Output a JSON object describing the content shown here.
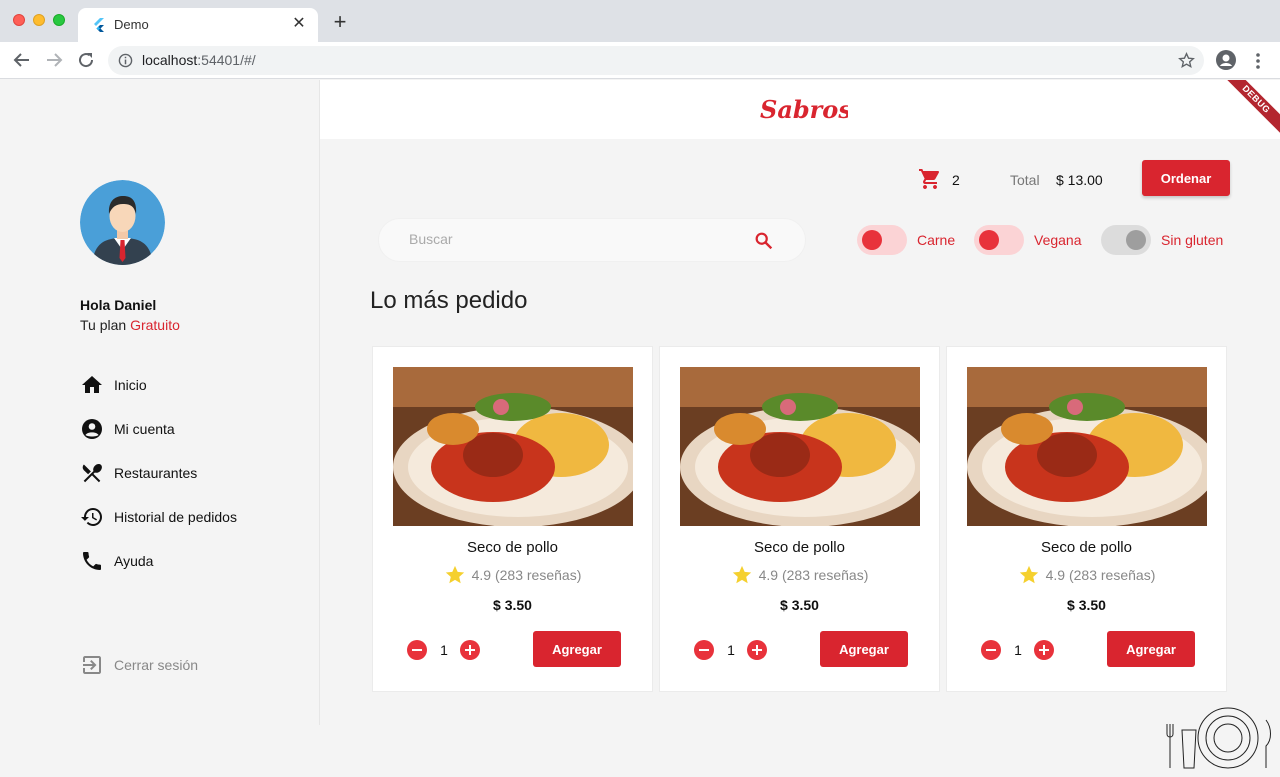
{
  "browser": {
    "tab_title": "Demo",
    "url_host": "localhost",
    "url_rest": ":54401/#/"
  },
  "colors": {
    "accent": "#d9252f",
    "switch_on": "#e8323b"
  },
  "sidebar": {
    "greeting": "Hola Daniel",
    "plan_label": "Tu plan",
    "plan_value": "Gratuito",
    "items": [
      {
        "label": "Inicio",
        "icon": "home-icon"
      },
      {
        "label": "Mi cuenta",
        "icon": "account-icon"
      },
      {
        "label": "Restaurantes",
        "icon": "restaurant-icon"
      },
      {
        "label": "Historial de pedidos",
        "icon": "history-icon"
      },
      {
        "label": "Ayuda",
        "icon": "phone-icon"
      }
    ],
    "logout_label": "Cerrar sesión"
  },
  "header": {
    "logo_text": "Sabroso",
    "debug_label": "DEBUG"
  },
  "cart": {
    "count": "2",
    "total_label": "Total",
    "total_value": "$ 13.00",
    "order_label": "Ordenar"
  },
  "search": {
    "placeholder": "Buscar",
    "value": ""
  },
  "filters": [
    {
      "label": "Carne",
      "on": true
    },
    {
      "label": "Vegana",
      "on": true
    },
    {
      "label": "Sin gluten",
      "on": false
    }
  ],
  "section_title": "Lo más pedido",
  "products": [
    {
      "name": "Seco de pollo",
      "rating": "4.9 (283 reseñas)",
      "price": "$ 3.50",
      "qty": "1",
      "add_label": "Agregar"
    },
    {
      "name": "Seco de pollo",
      "rating": "4.9 (283 reseñas)",
      "price": "$ 3.50",
      "qty": "1",
      "add_label": "Agregar"
    },
    {
      "name": "Seco de pollo",
      "rating": "4.9 (283 reseñas)",
      "price": "$ 3.50",
      "qty": "1",
      "add_label": "Agregar"
    }
  ]
}
